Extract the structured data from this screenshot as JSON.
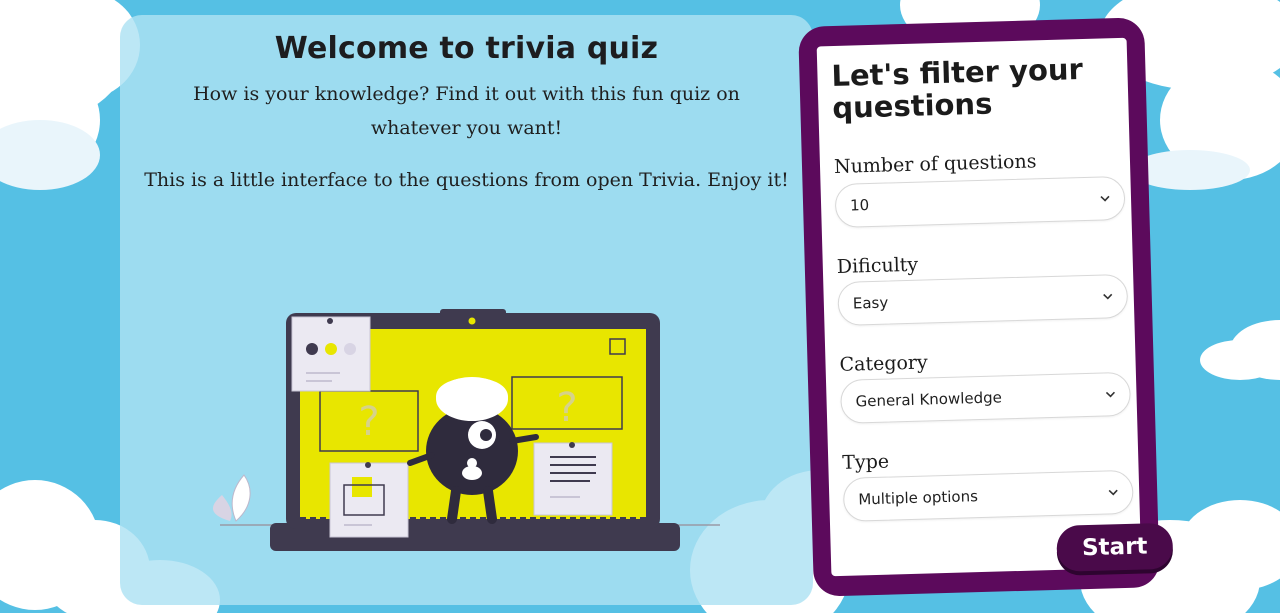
{
  "welcome": {
    "title": "Welcome to trivia quiz",
    "paragraph1": "How is your knowledge? Find it out with this fun quiz on whatever you want!",
    "paragraph2": "This is a little interface to the questions from open Trivia. Enjoy it!"
  },
  "illustration": {
    "icon": "laptop-quiz-character-illustration",
    "question_mark": "?"
  },
  "filter": {
    "title": "Let's filter your questions",
    "fields": [
      {
        "label": "Number of questions",
        "value": "10"
      },
      {
        "label": "Dificulty",
        "value": "Easy"
      },
      {
        "label": "Category",
        "value": "General Knowledge"
      },
      {
        "label": "Type",
        "value": "Multiple options"
      }
    ],
    "start_label": "Start"
  },
  "colors": {
    "sky": "#55c0e4",
    "panel": "#ade2f3",
    "frame": "#5c0a5c",
    "start_button": "#4a0a4a",
    "screen_yellow": "#e8e600",
    "laptop": "#3f3a4f"
  }
}
